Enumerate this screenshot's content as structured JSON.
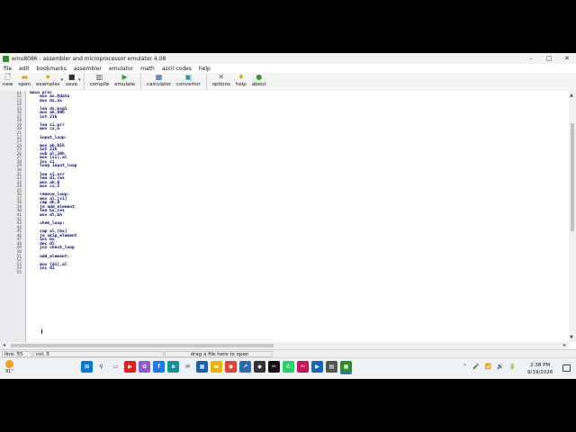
{
  "window": {
    "title": "emu8086 - assembler and microprocessor emulator 4.08"
  },
  "menu": [
    "file",
    "edit",
    "bookmarks",
    "assembler",
    "emulator",
    "math",
    "ascii codes",
    "help"
  ],
  "toolbar": [
    {
      "label": "new",
      "icon": "new-file-icon",
      "glyph": "🗋",
      "color": "#333333"
    },
    {
      "label": "open",
      "icon": "open-folder-icon",
      "glyph": "▬",
      "color": "#e0a020"
    },
    {
      "label": "examples",
      "icon": "star-icon",
      "glyph": "★",
      "color": "#d9a400"
    },
    {
      "label": "save",
      "icon": "save-disk-icon",
      "glyph": "■",
      "color": "#303030"
    },
    {
      "label": "compile",
      "icon": "compile-icon",
      "glyph": "▥",
      "color": "#555555"
    },
    {
      "label": "emulate",
      "icon": "emulate-play-icon",
      "glyph": "▶",
      "color": "#2aa02a"
    },
    {
      "label": "calculator",
      "icon": "calculator-icon",
      "glyph": "▦",
      "color": "#2060a0"
    },
    {
      "label": "convertor",
      "icon": "convertor-icon",
      "glyph": "▣",
      "color": "#2a8fb0"
    },
    {
      "label": "options",
      "icon": "options-tools-icon",
      "glyph": "✕",
      "color": "#555555"
    },
    {
      "label": "help",
      "icon": "help-bulb-icon",
      "glyph": "♦",
      "color": "#d0b000"
    },
    {
      "label": "about",
      "icon": "about-icon",
      "glyph": "●",
      "color": "#3a9a3a"
    }
  ],
  "editor": {
    "lines": [
      {
        "n": "11",
        "text": "main proc"
      },
      {
        "n": "12",
        "text": "    mov ax,@data"
      },
      {
        "n": "13",
        "text": "    mov ds,ax"
      },
      {
        "n": "14",
        "text": ""
      },
      {
        "n": "15",
        "text": "    lea dx,msg1"
      },
      {
        "n": "16",
        "text": "    mov ah,09h"
      },
      {
        "n": "17",
        "text": "    int 21h"
      },
      {
        "n": "18",
        "text": ""
      },
      {
        "n": "19",
        "text": "    lea si,arr"
      },
      {
        "n": "20",
        "text": "    mov cx,5"
      },
      {
        "n": "21",
        "text": ""
      },
      {
        "n": "22",
        "text": "    input_loop:"
      },
      {
        "n": "23",
        "text": ""
      },
      {
        "n": "24",
        "text": "    mov ah,01h"
      },
      {
        "n": "25",
        "text": "    int 21h"
      },
      {
        "n": "26",
        "text": "    sub al,30h"
      },
      {
        "n": "27",
        "text": "    mov [si],al"
      },
      {
        "n": "28",
        "text": "    inc si"
      },
      {
        "n": "29",
        "text": "    loop input_loop"
      },
      {
        "n": "30",
        "text": ""
      },
      {
        "n": "31",
        "text": "    lea si,arr"
      },
      {
        "n": "32",
        "text": "    lea di,res"
      },
      {
        "n": "33",
        "text": "    mov ah,0"
      },
      {
        "n": "34",
        "text": "    mov cx,5"
      },
      {
        "n": "35",
        "text": ""
      },
      {
        "n": "36",
        "text": "    remove_loop:"
      },
      {
        "n": "37",
        "text": "    mov al,[si]"
      },
      {
        "n": "38",
        "text": "    cmp dh,0"
      },
      {
        "n": "39",
        "text": "    je add_element"
      },
      {
        "n": "40",
        "text": "    lea bx,res"
      },
      {
        "n": "41",
        "text": "    mov dl,bh"
      },
      {
        "n": "42",
        "text": ""
      },
      {
        "n": "43",
        "text": "    chek_loop:"
      },
      {
        "n": "44",
        "text": ""
      },
      {
        "n": "45",
        "text": "    cmp al,[bx]"
      },
      {
        "n": "46",
        "text": "    je skip_element"
      },
      {
        "n": "47",
        "text": "    inc bx"
      },
      {
        "n": "48",
        "text": "    dec dl"
      },
      {
        "n": "49",
        "text": "    jnz check_loop"
      },
      {
        "n": "50",
        "text": ""
      },
      {
        "n": "51",
        "text": "    add_element:"
      },
      {
        "n": "52",
        "text": ""
      },
      {
        "n": "53",
        "text": "    mov [di],al"
      },
      {
        "n": "54",
        "text": "    inc di"
      },
      {
        "n": "55",
        "text": ""
      }
    ]
  },
  "status": {
    "line": "line: 55",
    "col": "col: 5",
    "hint": "drag a file here to open"
  },
  "taskbar": {
    "weather": "91°",
    "apps": [
      {
        "name": "windows-start-icon",
        "glyph": "⊞",
        "color": "#0078d4"
      },
      {
        "name": "search-icon",
        "glyph": "⚲",
        "color": "#333333"
      },
      {
        "name": "task-view-icon",
        "glyph": "▭",
        "color": "#333333"
      },
      {
        "name": "youtube-icon",
        "glyph": "▶",
        "color": "#e02020"
      },
      {
        "name": "photos-icon",
        "glyph": "✿",
        "color": "#8a5cd0"
      },
      {
        "name": "facebook-icon",
        "glyph": "f",
        "color": "#1877f2"
      },
      {
        "name": "edge-icon",
        "glyph": "e",
        "color": "#1a8f9a"
      },
      {
        "name": "mail-icon",
        "glyph": "✉",
        "color": "#444444"
      },
      {
        "name": "calculator-app-icon",
        "glyph": "▦",
        "color": "#1a5fb4"
      },
      {
        "name": "file-explorer-icon",
        "glyph": "▬",
        "color": "#f0b400"
      },
      {
        "name": "chrome-icon",
        "glyph": "◉",
        "color": "#db4437"
      },
      {
        "name": "app-blue-icon",
        "glyph": "↗",
        "color": "#2b6cb0"
      },
      {
        "name": "app-dark-icon",
        "glyph": "◆",
        "color": "#333333"
      },
      {
        "name": "capcut-icon",
        "glyph": "✂",
        "color": "#111111"
      },
      {
        "name": "whatsapp-icon",
        "glyph": "✆",
        "color": "#25d366"
      },
      {
        "name": "snipping-tool-icon",
        "glyph": "✄",
        "color": "#c2185b"
      },
      {
        "name": "media-player-icon",
        "glyph": "▶",
        "color": "#1565c0"
      },
      {
        "name": "app-gray-icon",
        "glyph": "▤",
        "color": "#555555"
      },
      {
        "name": "emu8086-task-icon",
        "glyph": "▦",
        "color": "#2e8b2e"
      }
    ],
    "tray": [
      "⌃",
      "🎤",
      "📶",
      "🔊",
      "🔋"
    ],
    "time": "2:38 PM",
    "date": "9/19/2026"
  }
}
